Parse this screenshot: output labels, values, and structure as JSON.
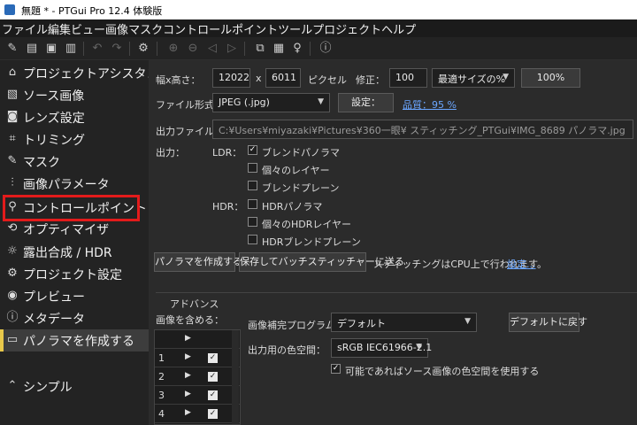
{
  "window": {
    "title": "無題 * - PTGui Pro 12.4 体験版"
  },
  "menu": [
    "ファイル",
    "編集",
    "ビュー",
    "画像",
    "マスク",
    "コントロールポイント",
    "ツール",
    "プロジェクト",
    "ヘルプ"
  ],
  "toolbar": {
    "icons": [
      "new-project-icon",
      "open-icon",
      "save-icon",
      "save-as-icon",
      "undo-icon",
      "redo-icon",
      "settings-icon",
      "zoom-in-icon",
      "zoom-out-icon",
      "previous-icon",
      "next-icon",
      "panorama-editor-icon",
      "table-icon",
      "light-bulb-icon",
      "help-icon"
    ]
  },
  "sidebar": {
    "items": [
      {
        "label": "プロジェクトアシスタント",
        "icon": "home-icon",
        "glyph": "⌂"
      },
      {
        "label": "ソース画像",
        "icon": "image-icon",
        "glyph": "▧"
      },
      {
        "label": "レンズ設定",
        "icon": "camera-icon",
        "glyph": "◙"
      },
      {
        "label": "トリミング",
        "icon": "crop-icon",
        "glyph": "⌗"
      },
      {
        "label": "マスク",
        "icon": "brush-icon",
        "glyph": "✎"
      },
      {
        "label": "画像パラメータ",
        "icon": "sliders-icon",
        "glyph": "⫶"
      },
      {
        "label": "コントロールポイント",
        "icon": "pin-icon",
        "glyph": "⚲"
      },
      {
        "label": "オプティマイザ",
        "icon": "optimizer-icon",
        "glyph": "⟲"
      },
      {
        "label": "露出合成 / HDR",
        "icon": "sun-icon",
        "glyph": "☼"
      },
      {
        "label": "プロジェクト設定",
        "icon": "gear-icon",
        "glyph": "⚙"
      },
      {
        "label": "プレビュー",
        "icon": "eye-icon",
        "glyph": "◉"
      },
      {
        "label": "メタデータ",
        "icon": "info-icon",
        "glyph": "ⓘ"
      },
      {
        "label": "パノラマを作成する",
        "icon": "panorama-icon",
        "glyph": "▭"
      }
    ],
    "simple_label": "シンプル",
    "simple_icon": "chevron-up-icon"
  },
  "size": {
    "label": "幅x高さ：",
    "width": "12022",
    "times": "x",
    "height": "6011",
    "unit": "ピクセル",
    "fix_label": "修正：",
    "fix_value": "100",
    "optimal": "最適サイズの%",
    "percent_btn": "100%"
  },
  "format": {
    "label": "ファイル形式：",
    "value": "JPEG (.jpg)",
    "settings_btn": "設定：",
    "quality_link": "品質：95 %"
  },
  "output_file": {
    "label": "出力ファイル：",
    "path": "C:¥Users¥miyazaki¥Pictures¥360一眼¥ スティッチング_PTGui¥IMG_8689 パノラマ.jpg"
  },
  "output": {
    "label": "出力：",
    "ldr_label": "LDR：",
    "ldr_options": [
      {
        "label": "ブレンドパノラマ",
        "checked": true
      },
      {
        "label": "個々のレイヤー",
        "checked": false
      },
      {
        "label": "ブレンドプレーン",
        "checked": false
      }
    ],
    "hdr_label": "HDR：",
    "hdr_options": [
      {
        "label": "HDRパノラマ",
        "checked": false
      },
      {
        "label": "個々のHDRレイヤー",
        "checked": false
      },
      {
        "label": "HDRブレンドプレーン",
        "checked": false
      }
    ]
  },
  "actions": {
    "create_btn": "パノラマを作成する",
    "batch_btn": "保存してバッチスティッチャーに送る",
    "stitch_info": "スティッチングはCPU上で行われます。",
    "stitch_settings_link": "設定..."
  },
  "advanced": {
    "title": "アドバンス",
    "include_label": "画像を含める：",
    "rows": [
      {
        "num": "1",
        "checked": true
      },
      {
        "num": "2",
        "checked": true
      },
      {
        "num": "3",
        "checked": true
      },
      {
        "num": "4",
        "checked": true
      }
    ],
    "interp_label": "画像補完プログラム：",
    "interp_value": "デフォルト",
    "default_btn": "デフォルトに戻す",
    "colorspace_label": "出力用の色空間：",
    "colorspace_value": "sRGB IEC61966-2.1",
    "use_source_label": "可能であればソース画像の色空間を使用する",
    "use_source_checked": true
  }
}
